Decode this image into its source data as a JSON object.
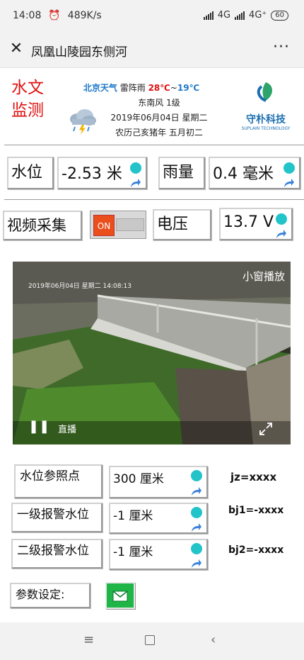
{
  "status": {
    "time": "14:08",
    "speed": "489K/s",
    "net1": "4G",
    "net2": "4G⁺",
    "battery": "60"
  },
  "titlebar": {
    "title": "凤凰山陵园东侧河"
  },
  "header": {
    "logo_line1": "水文",
    "logo_line2": "监测",
    "weather_city": "北京天气",
    "weather_desc": "雷阵雨",
    "temp_high": "28℃",
    "temp_sep": "~",
    "temp_low": "19℃",
    "wind": "东南风 1级",
    "date": "2019年06月04日 星期二",
    "lunar": "农历己亥猪年 五月初二",
    "brand_cn": "守朴科技",
    "brand_en": "SUPLAIN TECHNOLOGY"
  },
  "metrics": {
    "water_level_label": "水位",
    "water_level_value": "-2.53 米",
    "rain_label": "雨量",
    "rain_value": "0.4 毫米",
    "video_label": "视频采集",
    "toggle_label": "ON",
    "voltage_label": "电压",
    "voltage_value": "13.7 V"
  },
  "video": {
    "overlay_time": "2019年06月04日 星期二 14:08:13",
    "mini_label": "小窗播放",
    "live_label": "直播"
  },
  "params": {
    "ref_label": "水位参照点",
    "ref_value": "300 厘米",
    "ref_code": "jz=xxxx",
    "alarm1_label": "一级报警水位",
    "alarm1_value": "-1 厘米",
    "alarm1_code": "bj1=-xxxx",
    "alarm2_label": "二级报警水位",
    "alarm2_value": "-1 厘米",
    "alarm2_code": "bj2=-xxxx",
    "settings_label": "参数设定:"
  },
  "colors": {
    "accent_dot": "#22c3c9",
    "alert_red": "#e01010",
    "brand_blue": "#1d6fb0",
    "toggle_on": "#e94e1c",
    "settings_green": "#1fb547"
  }
}
